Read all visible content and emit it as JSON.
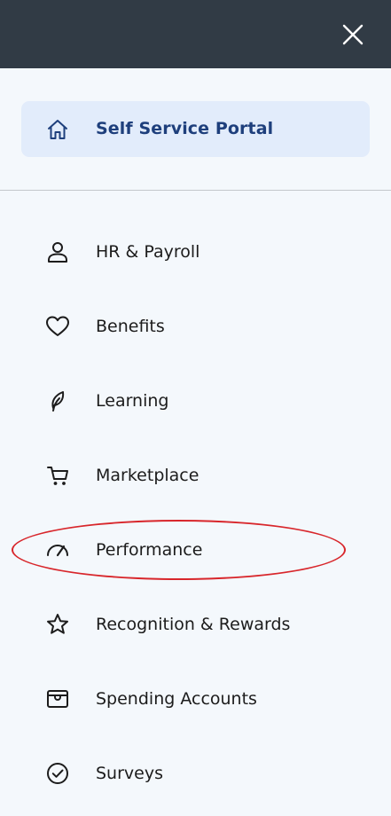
{
  "header": {
    "close_icon": "close-icon"
  },
  "portal": {
    "label": "Self Service Portal",
    "icon": "home-icon"
  },
  "menu": {
    "items": [
      {
        "label": "HR & Payroll",
        "icon": "user-icon"
      },
      {
        "label": "Benefits",
        "icon": "heart-icon"
      },
      {
        "label": "Learning",
        "icon": "leaf-icon"
      },
      {
        "label": "Marketplace",
        "icon": "cart-icon"
      },
      {
        "label": "Performance",
        "icon": "gauge-icon"
      },
      {
        "label": "Recognition & Rewards",
        "icon": "star-icon"
      },
      {
        "label": "Spending Accounts",
        "icon": "wallet-icon"
      },
      {
        "label": "Surveys",
        "icon": "check-circle-icon"
      }
    ]
  },
  "colors": {
    "header_bg": "#313b45",
    "page_bg": "#f4f8fc",
    "portal_bg": "#e2ecfb",
    "portal_text": "#1e3f7c",
    "annotation": "#d8262b"
  }
}
